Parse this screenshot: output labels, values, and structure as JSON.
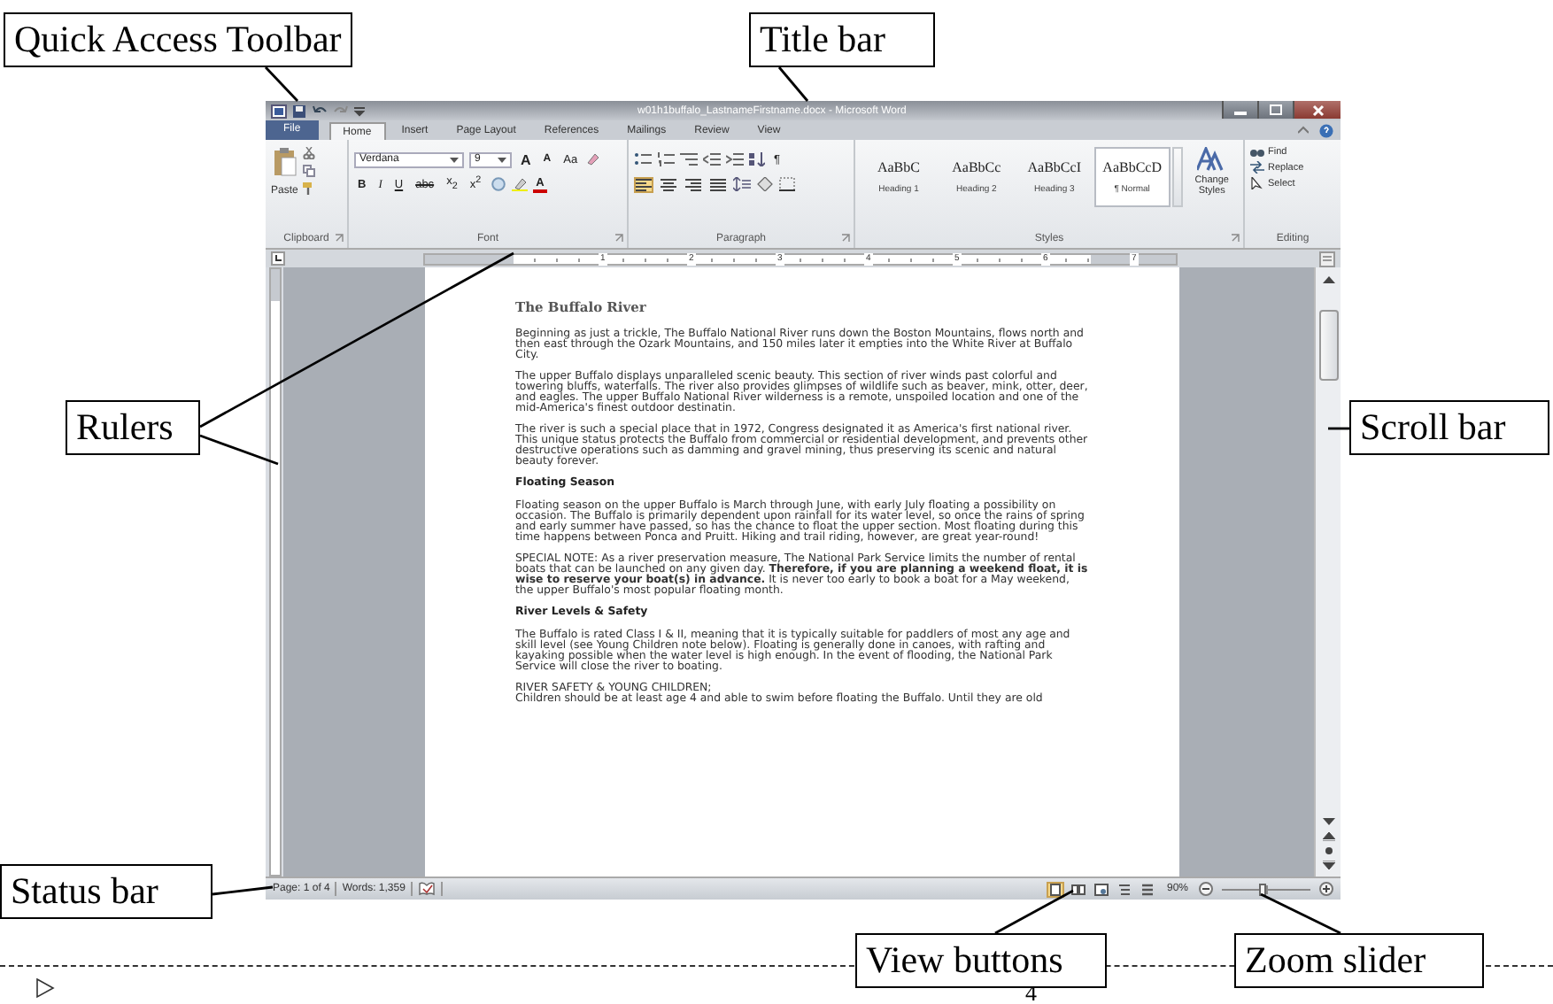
{
  "callouts": [
    {
      "text": "Quick Access Toolbar"
    },
    {
      "text": "Title bar"
    },
    {
      "text": "Rulers"
    },
    {
      "text": "Scroll bar"
    },
    {
      "text": "Status bar"
    },
    {
      "text": "View buttons"
    },
    {
      "text": "Zoom slider"
    }
  ],
  "window": {
    "title": "w01h1buffalo_LastnameFirstname.docx - Microsoft Word"
  },
  "tabs": [
    {
      "label": "File",
      "kind": "file",
      "selected": false
    },
    {
      "label": "Home",
      "kind": "tab",
      "selected": true
    },
    {
      "label": "Insert",
      "kind": "tab",
      "selected": false
    },
    {
      "label": "Page Layout",
      "kind": "tab",
      "selected": false
    },
    {
      "label": "References",
      "kind": "tab",
      "selected": false
    },
    {
      "label": "Mailings",
      "kind": "tab",
      "selected": false
    },
    {
      "label": "Review",
      "kind": "tab",
      "selected": false
    },
    {
      "label": "View",
      "kind": "tab",
      "selected": false
    }
  ],
  "ribbon": {
    "clipboard": {
      "label": "Clipboard",
      "paste": "Paste"
    },
    "font": {
      "label": "Font",
      "name": "Verdana",
      "size": "9",
      "grow": "A",
      "shrink": "A",
      "case": "Aa",
      "formats": [
        "B",
        "I",
        "U",
        "abc",
        "x$_{2}$",
        "x$^{2}$"
      ],
      "color_letter": "A"
    },
    "paragraph": {
      "label": "Paragraph",
      "show_marks": "¶",
      "alignments": [
        {
          "kind": "left",
          "selected": true
        },
        {
          "kind": "center",
          "selected": false
        },
        {
          "kind": "right",
          "selected": false
        },
        {
          "kind": "justify",
          "selected": false
        }
      ]
    },
    "styles": {
      "label": "Styles",
      "items": [
        {
          "sample": "AaBbC",
          "name": "Heading 1",
          "selected": false
        },
        {
          "sample": "AaBbCc",
          "name": "Heading 2",
          "selected": false
        },
        {
          "sample": "AaBbCcI",
          "name": "Heading 3",
          "selected": false
        },
        {
          "sample": "AaBbCcD",
          "name": "¶ Normal",
          "selected": true
        }
      ],
      "change": "Change Styles"
    },
    "editing": {
      "label": "Editing",
      "items": [
        {
          "kind": "find",
          "label": "Find"
        },
        {
          "kind": "replace",
          "label": "Replace"
        },
        {
          "kind": "select",
          "label": "Select"
        }
      ]
    }
  },
  "ruler": {
    "numbers": [
      "1",
      "2",
      "3",
      "4",
      "5",
      "6",
      "7"
    ]
  },
  "document": {
    "title": "The Buffalo River",
    "blocks": [
      {
        "kind": "p",
        "text": "Beginning as just a trickle, The Buffalo National River runs down the Boston Mountains, flows north and then east through the Ozark Mountains, and 150 miles later it empties into the White River at Buffalo City."
      },
      {
        "kind": "p",
        "text": "The upper Buffalo displays unparalleled scenic beauty. This section of river winds past colorful and towering bluffs, waterfalls.  The river also provides glimpses of wildlife such as beaver, mink, otter, deer, and eagles. The upper Buffalo National River wilderness is a remote, unspoiled location and one of the mid-America's finest outdoor destinatin."
      },
      {
        "kind": "p",
        "text": "The river is such a special place that in 1972, Congress designated it as America's first national river. This unique status protects the Buffalo from commercial or residential development, and prevents other destructive operations such as damming and gravel mining, thus preserving its scenic and natural beauty forever."
      },
      {
        "kind": "heading",
        "text": "Floating Season"
      },
      {
        "kind": "p",
        "text": "Floating season on the upper Buffalo is March through June, with early July floating a possibility on occasion. The Buffalo is primarily dependent upon rainfall for its water level, so once the rains of spring and early summer have passed, so has the chance to float the upper section. Most floating during this time happens between Ponca and Pruitt. Hiking and trail riding, however, are great year-round!"
      },
      {
        "kind": "p",
        "text": "SPECIAL NOTE: As a river preservation measure, The National Park Service limits the number of rental boats that can be launched on any given day. **Therefore, if you are planning a weekend float, it is wise to reserve your boat(s) in advance.** It is never too early to book a boat for a May weekend, the upper Buffalo's most popular floating month."
      },
      {
        "kind": "heading",
        "text": "River Levels & Safety"
      },
      {
        "kind": "p",
        "text": "The Buffalo is rated Class I & II, meaning that it is typically suitable for paddlers of most any age and skill level (see Young Children note below). Floating is generally done in canoes, with rafting and kayaking possible when the water level is high enough. In the event of flooding, the National Park Service will close the river to boating."
      },
      {
        "kind": "lines",
        "lines": [
          "RIVER SAFETY & YOUNG CHILDREN;",
          "Children should be at least age 4 and able to swim before floating the Buffalo. Until they are old"
        ]
      }
    ]
  },
  "status_bar": {
    "page": "Page: 1 of 4",
    "words": "Words: 1,359",
    "views": [
      {
        "kind": "print",
        "selected": true
      },
      {
        "kind": "reading",
        "selected": false
      },
      {
        "kind": "web",
        "selected": false
      },
      {
        "kind": "outline",
        "selected": false
      },
      {
        "kind": "draft",
        "selected": false
      }
    ],
    "zoom": "90%",
    "zoom_slider": {
      "level": 0.45
    }
  },
  "footer": {
    "page_number": "4"
  }
}
